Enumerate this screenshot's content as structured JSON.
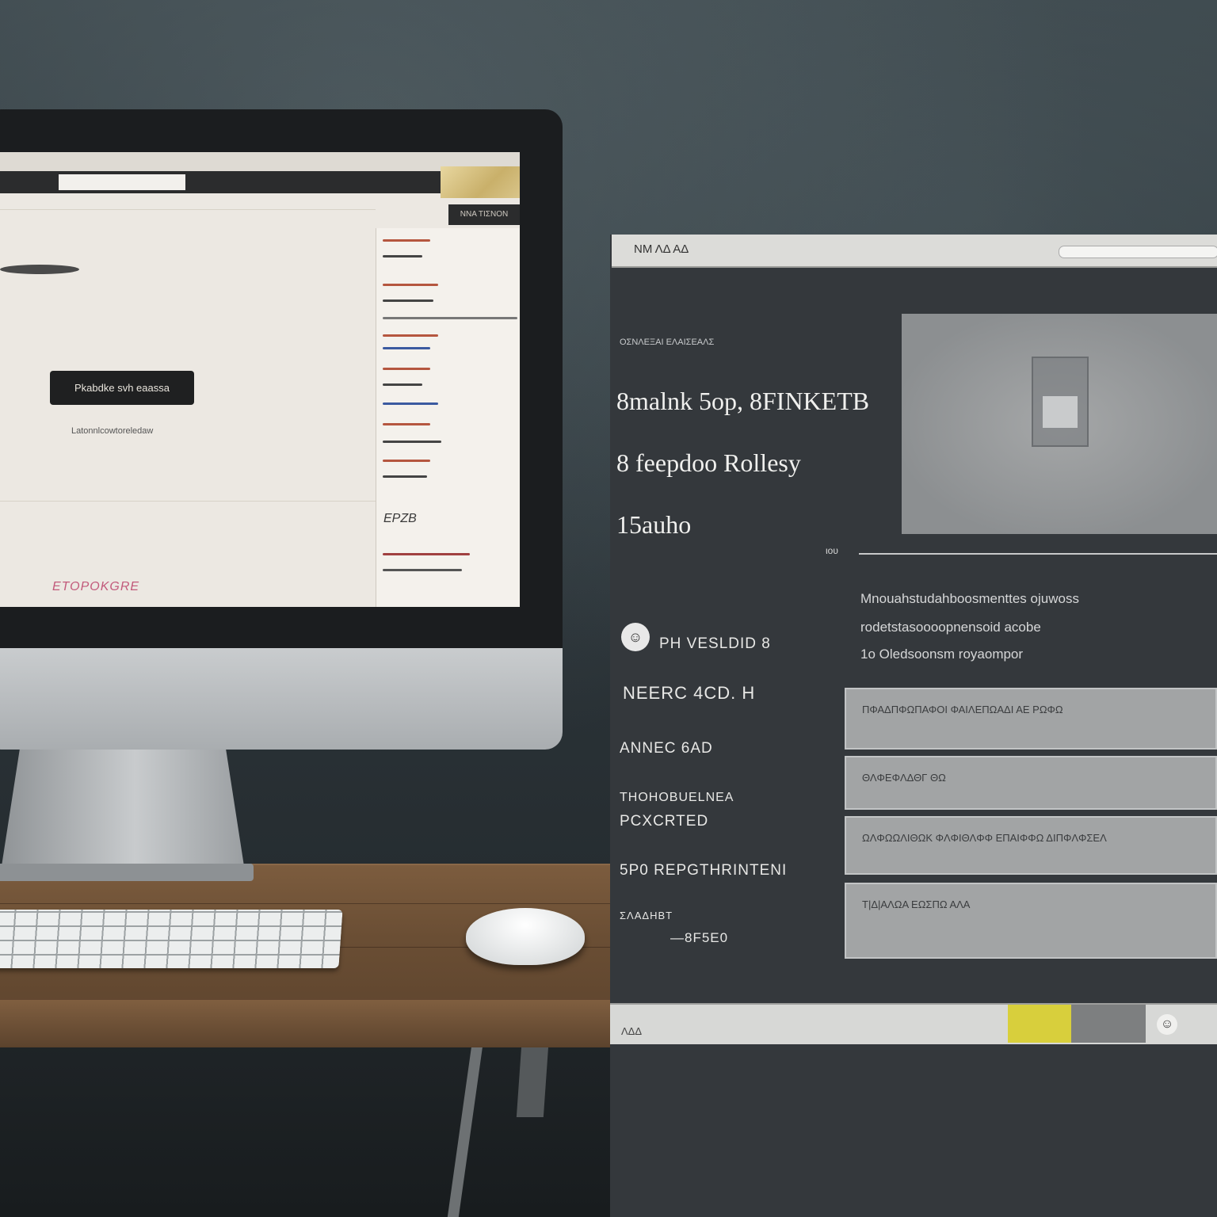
{
  "monitor": {
    "screen_button": "Pkabdke svh eaassa",
    "screen_subtext": "Latonnlcowtoreledaw",
    "screen_pink_text": "ETOPOKGRE",
    "screen_price": "ΕΡΖΒ",
    "screen_corner_button": "ΝΝΑ ΤΙΣΝΟΝ"
  },
  "panel": {
    "top_bar_text": "ΝΜ  ΛΔ  ΑΔ",
    "small_label": "ΟΣΝΛΕΞΑΙ ΕΛΑΙΣΕΑΛΣ",
    "heading_line_1": "8malnk 5op, 8FINKETB",
    "heading_line_2": "8 feepdoo  Rollesy",
    "heading_line_3": "15auho",
    "rule_label": "ιου",
    "description_line_1": "Mnouahstudahboosmenttes ojuwoss",
    "description_line_2": "rodetstasoooopnensoid acobe",
    "description_line_3": "1o Oledsoonsm royaompor",
    "badge_icon": "☺",
    "label_1": "PH VESLDID 8",
    "label_2": "NEERC 4CD.  H",
    "label_3": "ANNEC 6AD",
    "label_4a": "THOHOBUELNEA",
    "label_4b": "PCXCRTED",
    "label_5": "5P0  REPGTHRINTENI",
    "label_6": "ΣΛΑΔΗΒΤ",
    "label_7": "—8F5E0",
    "field_1": "ΠΦΑΔΠΦΩΠΑΦΟΙ ΦΑΙΛΕΠΩΑΔΙ ΑΕ ΡΩΦΩ",
    "field_2": "ΘΛΦΕΦΛΔΘΓ ΘΩ",
    "field_3": "ΩΛΦΩΩΛΙΘΩΚ ΦΛΦΙΘΛΦΦ  ΕΠΑΙΦΦΩ ΔΙΠΦΛΦΣΕΛ",
    "field_4": "Τ|Δ|ΑΛΩΑ ΕΩΣΠΩ ΑΛΑ",
    "bottom_text": "ΛΔΔ",
    "colors": {
      "panel_bg": "#34383c",
      "field_bg": "#a2a4a5",
      "yellow_accent": "#d8cf3c"
    }
  }
}
